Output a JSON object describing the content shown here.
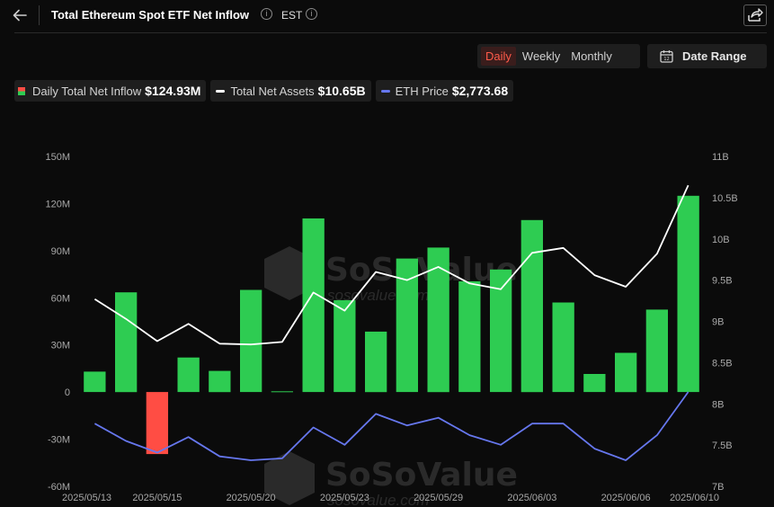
{
  "header": {
    "back_icon": "arrow-left-icon",
    "title": "Total Ethereum Spot ETF Net Inflow",
    "timezone": "EST",
    "share_icon": "share-icon"
  },
  "controls": {
    "periods": [
      "Daily",
      "Weekly",
      "Monthly"
    ],
    "active_period": "Daily",
    "date_range_label": "Date Range",
    "calendar_icon": "calendar-icon"
  },
  "legend": {
    "inflow": {
      "name": "Daily Total Net Inflow",
      "value": "$124.93M"
    },
    "assets": {
      "name": "Total Net Assets",
      "value": "$10.65B"
    },
    "eth": {
      "name": "ETH Price",
      "value": "$2,773.68"
    }
  },
  "watermark": {
    "brand": "SoSoValue",
    "domain": "sosovalue.com"
  },
  "colors": {
    "positive": "#2ecc52",
    "negative": "#ff4d44",
    "assets_line": "#ffffff",
    "eth_line": "#6677ee",
    "active_period": "#ff5b4a"
  },
  "chart_data": {
    "type": "bar",
    "x": [
      "2025/05/13",
      "2025/05/14",
      "2025/05/15",
      "2025/05/16",
      "2025/05/19",
      "2025/05/20",
      "2025/05/21",
      "2025/05/22",
      "2025/05/23",
      "2025/05/27",
      "2025/05/28",
      "2025/05/29",
      "2025/05/30",
      "2025/06/02",
      "2025/06/03",
      "2025/06/04",
      "2025/06/05",
      "2025/06/06",
      "2025/06/09",
      "2025/06/10"
    ],
    "x_tick_labels": [
      "2025/05/13",
      "2025/05/15",
      "2025/05/20",
      "2025/05/23",
      "2025/05/29",
      "2025/06/03",
      "2025/06/06",
      "2025/06/10"
    ],
    "series": [
      {
        "name": "Daily Total Net Inflow",
        "type": "bar",
        "axis": "left",
        "values": [
          13,
          63.5,
          -39.5,
          22,
          13.5,
          65,
          0.5,
          110.5,
          58.5,
          38.5,
          85,
          92,
          70.5,
          78,
          109.5,
          57,
          11.5,
          25,
          52.5,
          124.93
        ]
      },
      {
        "name": "Total Net Assets",
        "type": "line",
        "axis": "right",
        "values": [
          9.27,
          9.03,
          8.76,
          8.97,
          8.73,
          8.72,
          8.75,
          9.35,
          9.13,
          9.6,
          9.5,
          9.66,
          9.46,
          9.39,
          9.83,
          9.89,
          9.56,
          9.42,
          9.82,
          10.65
        ]
      },
      {
        "name": "ETH Price",
        "type": "line",
        "axis": "hidden",
        "values": [
          2610,
          2520,
          2460,
          2540,
          2440,
          2420,
          2430,
          2590,
          2500,
          2660,
          2600,
          2640,
          2550,
          2500,
          2610,
          2610,
          2480,
          2420,
          2550,
          2773.68
        ]
      }
    ],
    "left_axis": {
      "ticks": [
        "150M",
        "120M",
        "90M",
        "60M",
        "30M",
        "0",
        "-30M",
        "-60M"
      ],
      "range": [
        -60,
        150
      ]
    },
    "right_axis": {
      "ticks": [
        "11B",
        "10.5B",
        "10B",
        "9.5B",
        "9B",
        "8.5B",
        "8B",
        "7.5B",
        "7B"
      ],
      "range": [
        7,
        11
      ]
    },
    "grid": false,
    "legend_position": "top-left"
  }
}
